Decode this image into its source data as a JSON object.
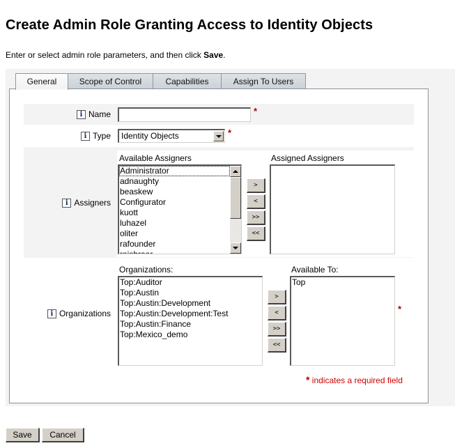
{
  "page": {
    "title": "Create Admin Role Granting Access to Identity Objects",
    "instructions_prefix": "Enter or select admin role parameters, and then click ",
    "instructions_bold": "Save",
    "instructions_suffix": "."
  },
  "tabs": [
    {
      "label": "General",
      "active": true
    },
    {
      "label": "Scope of Control",
      "active": false
    },
    {
      "label": "Capabilities",
      "active": false
    },
    {
      "label": "Assign To Users",
      "active": false
    }
  ],
  "form": {
    "name": {
      "label": "Name",
      "value": "",
      "required": true,
      "icon": "info-icon"
    },
    "type": {
      "label": "Type",
      "selected": "Identity Objects",
      "required": true,
      "icon": "info-icon"
    },
    "assigners": {
      "label": "Assigners",
      "icon": "info-icon",
      "available_label": "Available Assigners",
      "available": [
        "Administrator",
        "adnaughty",
        "beaskew",
        "Configurator",
        "kuott",
        "luhazel",
        "oliter",
        "rafounder",
        "raishraar"
      ],
      "assigned_label": "Assigned Assigners",
      "assigned": []
    },
    "organizations": {
      "label": "Organizations",
      "icon": "info-icon",
      "required": true,
      "available_label": "Organizations:",
      "available": [
        "Top:Auditor",
        "Top:Austin",
        "Top:Austin:Development",
        "Top:Austin:Development:Test",
        "Top:Austin:Finance",
        "Top:Mexico_demo"
      ],
      "assigned_label": "Available To:",
      "assigned": [
        "Top"
      ]
    },
    "move_buttons": {
      "add": ">",
      "remove": "<",
      "add_all": ">>",
      "remove_all": "<<"
    },
    "required_star": "*",
    "required_note": "indicates a required field"
  },
  "buttons": {
    "save": "Save",
    "cancel": "Cancel"
  },
  "colors": {
    "required": "#d00000",
    "panel": "#f3f3f3",
    "tab_border": "#8f979f"
  }
}
